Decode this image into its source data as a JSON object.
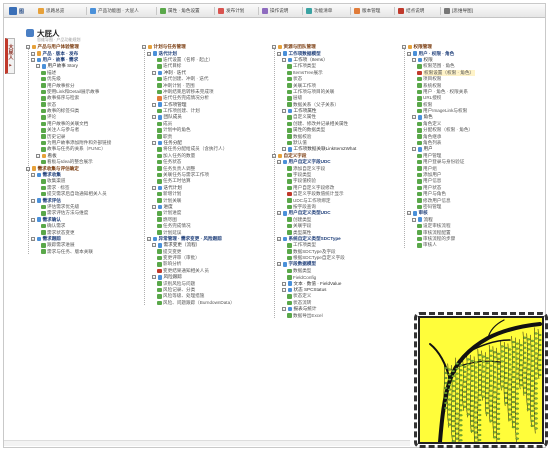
{
  "toolbar": {
    "logo_text": "图",
    "buttons": [
      {
        "label": "思路总览",
        "icon": "folder-icon",
        "color": "#e7a13a"
      },
      {
        "label": "产品功能图 · 大屁人",
        "icon": "map-icon",
        "color": "#4a90d9"
      },
      {
        "label": "属性 · 角色设置",
        "icon": "people-icon",
        "color": "#5aa84a"
      },
      {
        "label": "发布计划",
        "icon": "calendar-icon",
        "color": "#d9534f"
      },
      {
        "label": "操作说明",
        "icon": "book-icon",
        "color": "#8e6bbf"
      },
      {
        "label": "功能清单",
        "icon": "list-icon",
        "color": "#3aa3a3"
      },
      {
        "label": "版本管理",
        "icon": "tag-icon",
        "color": "#e07b39"
      },
      {
        "label": "结点说明",
        "icon": "info-icon",
        "color": "#c0392b"
      },
      {
        "label": "[思维导图]",
        "icon": "mindmap-icon",
        "color": "#777777"
      }
    ]
  },
  "sidetab": {
    "label": "大屁人 ▸"
  },
  "root": {
    "title": "大屁人",
    "subtitle": "思维导图 · 产品功能规划"
  },
  "columns": [
    {
      "nodes": [
        {
          "level": 0,
          "label": "产品与用户体验管理",
          "icon": "#e7a13a"
        },
        {
          "level": 1,
          "label": "产品 · 版本 · 发布",
          "icon": "#e7a13a"
        },
        {
          "level": 1,
          "label": "用户 · 故事 · 需求",
          "icon": "#4a90d9"
        },
        {
          "level": 2,
          "label": "用户故事 Story",
          "icon": "#4a90d9"
        },
        {
          "level": 3,
          "label": "描述",
          "icon": "#5aa84a"
        },
        {
          "level": 3,
          "label": "优先级",
          "icon": "#5aa84a"
        },
        {
          "level": 3,
          "label": "用户故事拆分",
          "icon": "#5aa84a"
        },
        {
          "level": 3,
          "label": "使用Link和Detail展示故事",
          "icon": "#5aa84a"
        },
        {
          "level": 3,
          "label": "故事排序与检索",
          "icon": "#5aa84a"
        },
        {
          "level": 3,
          "label": "状态",
          "icon": "#5aa84a"
        },
        {
          "level": 3,
          "label": "故事的标签归类",
          "icon": "#5aa84a"
        },
        {
          "level": 3,
          "label": "评论",
          "icon": "#5aa84a"
        },
        {
          "level": 3,
          "label": "用户故事的关联文档",
          "icon": "#5aa84a"
        },
        {
          "level": 3,
          "label": "关注人与参与者",
          "icon": "#5aa84a"
        },
        {
          "level": 3,
          "label": "历史记录",
          "icon": "#5aa84a"
        },
        {
          "level": 3,
          "label": "为用户故事添加附件和外部链接",
          "icon": "#5aa84a"
        },
        {
          "level": 3,
          "label": "故事与任务的关系（FUNC）",
          "icon": "#5aa84a"
        },
        {
          "level": 2,
          "label": "看板",
          "icon": "#e7a13a"
        },
        {
          "level": 3,
          "label": "看板与Idea的整合展示",
          "icon": "#5aa84a"
        },
        {
          "level": 0,
          "label": "需求收集与评估确定",
          "icon": "#e7a13a"
        },
        {
          "level": 1,
          "label": "需求收集",
          "icon": "#4a90d9"
        },
        {
          "level": 3,
          "label": "收集渠道",
          "icon": "#5aa84a"
        },
        {
          "level": 3,
          "label": "需求 · 标签",
          "icon": "#5aa84a"
        },
        {
          "level": 3,
          "label": "提交需求后自动通知相关人员",
          "icon": "#5aa84a"
        },
        {
          "level": 1,
          "label": "需求评估",
          "icon": "#4a90d9"
        },
        {
          "level": 3,
          "label": "评估需求优先级",
          "icon": "#5aa84a"
        },
        {
          "level": 3,
          "label": "需求评估方法与维度",
          "icon": "#5aa84a"
        },
        {
          "level": 1,
          "label": "需求确认",
          "icon": "#4a90d9"
        },
        {
          "level": 3,
          "label": "确认需求",
          "icon": "#5aa84a"
        },
        {
          "level": 3,
          "label": "需求状态变更",
          "icon": "#5aa84a"
        },
        {
          "level": 1,
          "label": "需求跟踪",
          "icon": "#4a90d9"
        },
        {
          "level": 3,
          "label": "跟踪需求进展",
          "icon": "#5aa84a"
        },
        {
          "level": 3,
          "label": "需求与任务、版本关联",
          "icon": "#5aa84a"
        }
      ]
    },
    {
      "nodes": [
        {
          "level": 0,
          "label": "计划与任务管理",
          "icon": "#e7a13a"
        },
        {
          "level": 1,
          "label": "迭代计划",
          "icon": "#4a90d9"
        },
        {
          "level": 3,
          "label": "迭代设置（名称 · 起止）",
          "icon": "#5aa84a"
        },
        {
          "level": 3,
          "label": "迭代目标",
          "icon": "#5aa84a"
        },
        {
          "level": 2,
          "label": "冲刺 · 迭代",
          "icon": "#4a90d9"
        },
        {
          "level": 3,
          "label": "迭代创建、冲刺 · 迭代",
          "icon": "#5aa84a"
        },
        {
          "level": 3,
          "label": "冲刺计划 · 范围",
          "icon": "#5aa84a"
        },
        {
          "level": 3,
          "label": "冲刺结束后转移未完成项",
          "icon": "#5aa84a"
        },
        {
          "level": 3,
          "label": "迭代任务完成情况分析",
          "icon": "#e07b39"
        },
        {
          "level": 2,
          "label": "工作项管理",
          "icon": "#4a90d9"
        },
        {
          "level": 3,
          "label": "工作项创建、计划",
          "icon": "#5aa84a"
        },
        {
          "level": 2,
          "label": "团队成员",
          "icon": "#4a90d9"
        },
        {
          "level": 3,
          "label": "成员",
          "icon": "#5aa84a"
        },
        {
          "level": 3,
          "label": "计划中的角色",
          "icon": "#5aa84a"
        },
        {
          "level": 3,
          "label": "职责",
          "icon": "#5aa84a"
        },
        {
          "level": 2,
          "label": "任务分配",
          "icon": "#4a90d9"
        },
        {
          "level": 3,
          "label": "将任务分配给成员（含执行人）",
          "icon": "#5aa84a"
        },
        {
          "level": 3,
          "label": "加入任务的数量",
          "icon": "#5aa84a"
        },
        {
          "level": 3,
          "label": "任务状态",
          "icon": "#5aa84a"
        },
        {
          "level": 3,
          "label": "任务负责人调整",
          "icon": "#5aa84a"
        },
        {
          "level": 3,
          "label": "关联任务与需求工作项",
          "icon": "#5aa84a"
        },
        {
          "level": 3,
          "label": "任务工时估算",
          "icon": "#5aa84a"
        },
        {
          "level": 2,
          "label": "迭代计划",
          "icon": "#4a90d9"
        },
        {
          "level": 3,
          "label": "新增计划",
          "icon": "#5aa84a"
        },
        {
          "level": 3,
          "label": "计划关联",
          "icon": "#5aa84a"
        },
        {
          "level": 2,
          "label": "进度",
          "icon": "#4a90d9"
        },
        {
          "level": 3,
          "label": "计划进度",
          "icon": "#5aa84a"
        },
        {
          "level": 3,
          "label": "燃尽图",
          "icon": "#5aa84a"
        },
        {
          "level": 3,
          "label": "任务完成情况",
          "icon": "#5aa84a"
        },
        {
          "level": 3,
          "label": "计划延误",
          "icon": "#5aa84a"
        },
        {
          "level": 1,
          "label": "异常管理 · 需求变更 · 风险跟踪",
          "icon": "#4a90d9"
        },
        {
          "level": 2,
          "label": "需求变更（流程）",
          "icon": "#4a90d9"
        },
        {
          "level": 3,
          "label": "提交变更",
          "icon": "#5aa84a"
        },
        {
          "level": 3,
          "label": "变更评审（审批）",
          "icon": "#5aa84a"
        },
        {
          "level": 3,
          "label": "影响分析",
          "icon": "#5aa84a"
        },
        {
          "level": 3,
          "label": "变更结果通知相关人员",
          "icon": "#c0392b"
        },
        {
          "level": 2,
          "label": "风险跟踪",
          "icon": "#4a90d9"
        },
        {
          "level": 3,
          "label": "识别风险与问题",
          "icon": "#5aa84a"
        },
        {
          "level": 3,
          "label": "风险记录、分类",
          "icon": "#5aa84a"
        },
        {
          "level": 3,
          "label": "风险等级、处理措施",
          "icon": "#5aa84a"
        },
        {
          "level": 3,
          "label": "风险、问题跟踪（BurndownData）",
          "icon": "#5aa84a"
        }
      ]
    },
    {
      "nodes": [
        {
          "level": 0,
          "label": "资源与团队管理",
          "icon": "#e7a13a"
        },
        {
          "level": 1,
          "label": "工作项数据模型",
          "icon": "#4a90d9"
        },
        {
          "level": 2,
          "label": "工作项（Items）",
          "icon": "#4a90d9"
        },
        {
          "level": 3,
          "label": "工作项类型",
          "icon": "#5aa84a"
        },
        {
          "level": 3,
          "label": "ItemsTree展示",
          "icon": "#5aa84a"
        },
        {
          "level": 3,
          "label": "状态",
          "icon": "#5aa84a"
        },
        {
          "level": 3,
          "label": "关联工作项",
          "icon": "#5aa84a"
        },
        {
          "level": 3,
          "label": "工作项与项目的关联",
          "icon": "#5aa84a"
        },
        {
          "level": 3,
          "label": "层级",
          "icon": "#5aa84a"
        },
        {
          "level": 3,
          "label": "数据关系（父子关系）",
          "icon": "#5aa84a"
        },
        {
          "level": 2,
          "label": "工作项属性",
          "icon": "#4a90d9"
        },
        {
          "level": 3,
          "label": "自定义属性",
          "icon": "#5aa84a"
        },
        {
          "level": 3,
          "label": "创建、修改并记录相关属性",
          "icon": "#5aa84a"
        },
        {
          "level": 3,
          "label": "属性的数据类型",
          "icon": "#5aa84a"
        },
        {
          "level": 3,
          "label": "数据校验",
          "icon": "#5aa84a"
        },
        {
          "level": 3,
          "label": "默认值",
          "icon": "#5aa84a"
        },
        {
          "level": 2,
          "label": "工作项数据关联LinkItem2What",
          "icon": "#4a90d9"
        },
        {
          "level": 0,
          "label": "自定义字段",
          "icon": "#e7a13a"
        },
        {
          "level": 1,
          "label": "用户自定义字段UDC",
          "icon": "#4a90d9"
        },
        {
          "level": 3,
          "label": "添加自定义字段",
          "icon": "#5aa84a"
        },
        {
          "level": 3,
          "label": "字段类型",
          "icon": "#5aa84a"
        },
        {
          "level": 3,
          "label": "字段值校验",
          "icon": "#5aa84a"
        },
        {
          "level": 3,
          "label": "用户自定义字段修改",
          "icon": "#5aa84a"
        },
        {
          "level": 3,
          "label": "自定义字段数值统计显示",
          "icon": "#c0392b"
        },
        {
          "level": 3,
          "label": "UDC与工作项绑定",
          "icon": "#5aa84a"
        },
        {
          "level": 3,
          "label": "按字段查询",
          "icon": "#5aa84a"
        },
        {
          "level": 1,
          "label": "用户自定义类型UDC",
          "icon": "#4a90d9"
        },
        {
          "level": 3,
          "label": "创建类型",
          "icon": "#5aa84a"
        },
        {
          "level": 3,
          "label": "关联字段",
          "icon": "#5aa84a"
        },
        {
          "level": 3,
          "label": "类型属性",
          "icon": "#5aa84a"
        },
        {
          "level": 1,
          "label": "系统自定义类型SDCType",
          "icon": "#4a90d9"
        },
        {
          "level": 3,
          "label": "工作项类型",
          "icon": "#5aa84a"
        },
        {
          "level": 3,
          "label": "数据SDCType及字段",
          "icon": "#5aa84a"
        },
        {
          "level": 3,
          "label": "根据SDCType自定义字段",
          "icon": "#5aa84a"
        },
        {
          "level": 1,
          "label": "字段数据模型",
          "icon": "#4a90d9"
        },
        {
          "level": 3,
          "label": "数据类型",
          "icon": "#5aa84a"
        },
        {
          "level": 3,
          "label": "FieldConfig",
          "icon": "#5aa84a"
        },
        {
          "level": 2,
          "label": "文本 · 数值 · FieldValue",
          "icon": "#4a90d9"
        },
        {
          "level": 2,
          "label": "状态 SPCStatus",
          "icon": "#4a90d9"
        },
        {
          "level": 3,
          "label": "状态定义",
          "icon": "#5aa84a"
        },
        {
          "level": 3,
          "label": "状态流转",
          "icon": "#5aa84a"
        },
        {
          "level": 2,
          "label": "报表与统计",
          "icon": "#4a90d9"
        },
        {
          "level": 3,
          "label": "数据导出Excel",
          "icon": "#5aa84a"
        }
      ]
    },
    {
      "nodes": [
        {
          "level": 0,
          "label": "权限管理",
          "icon": "#e7a13a"
        },
        {
          "level": 1,
          "label": "用户 · 权限 · 角色",
          "icon": "#4a90d9"
        },
        {
          "level": 2,
          "label": "权限",
          "icon": "#4a90d9"
        },
        {
          "level": 3,
          "label": "权限范围 · 角色",
          "icon": "#5aa84a"
        },
        {
          "level": 3,
          "label": "权限设置（权限 · 角色）",
          "icon": "#c0392b",
          "highlight": true
        },
        {
          "level": 3,
          "label": "项目权限",
          "icon": "#5aa84a"
        },
        {
          "level": 3,
          "label": "系统权限",
          "icon": "#5aa84a"
        },
        {
          "level": 3,
          "label": "用户 · 角色 · 权限关系",
          "icon": "#5aa84a"
        },
        {
          "level": 3,
          "label": "URL授权",
          "icon": "#5aa84a"
        },
        {
          "level": 3,
          "label": "权限",
          "icon": "#5aa84a"
        },
        {
          "level": 3,
          "label": "用户ImageLink与权限",
          "icon": "#5aa84a"
        },
        {
          "level": 2,
          "label": "角色",
          "icon": "#4a90d9"
        },
        {
          "level": 3,
          "label": "角色定义",
          "icon": "#5aa84a"
        },
        {
          "level": 3,
          "label": "分配权限（权限 · 角色）",
          "icon": "#5aa84a"
        },
        {
          "level": 3,
          "label": "角色继承",
          "icon": "#5aa84a"
        },
        {
          "level": 3,
          "label": "角色列表",
          "icon": "#5aa84a"
        },
        {
          "level": 2,
          "label": "用户",
          "icon": "#4a90d9"
        },
        {
          "level": 3,
          "label": "用户管理",
          "icon": "#5aa84a"
        },
        {
          "level": 3,
          "label": "用户登录与身份验证",
          "icon": "#5aa84a"
        },
        {
          "level": 3,
          "label": "用户组",
          "icon": "#5aa84a"
        },
        {
          "level": 3,
          "label": "添加用户",
          "icon": "#5aa84a"
        },
        {
          "level": 3,
          "label": "用户信息",
          "icon": "#5aa84a"
        },
        {
          "level": 3,
          "label": "用户状态",
          "icon": "#5aa84a"
        },
        {
          "level": 3,
          "label": "用户与角色",
          "icon": "#5aa84a"
        },
        {
          "level": 3,
          "label": "修改用户信息",
          "icon": "#5aa84a"
        },
        {
          "level": 3,
          "label": "密码管理",
          "icon": "#5aa84a"
        },
        {
          "level": 1,
          "label": "审核",
          "icon": "#4a90d9"
        },
        {
          "level": 2,
          "label": "流程",
          "icon": "#4a90d9"
        },
        {
          "level": 3,
          "label": "设定审核流程",
          "icon": "#5aa84a"
        },
        {
          "level": 3,
          "label": "审核流程配置",
          "icon": "#5aa84a"
        },
        {
          "level": 3,
          "label": "审核流程的步骤",
          "icon": "#5aa84a"
        },
        {
          "level": 3,
          "label": "审核人",
          "icon": "#5aa84a"
        }
      ]
    }
  ]
}
